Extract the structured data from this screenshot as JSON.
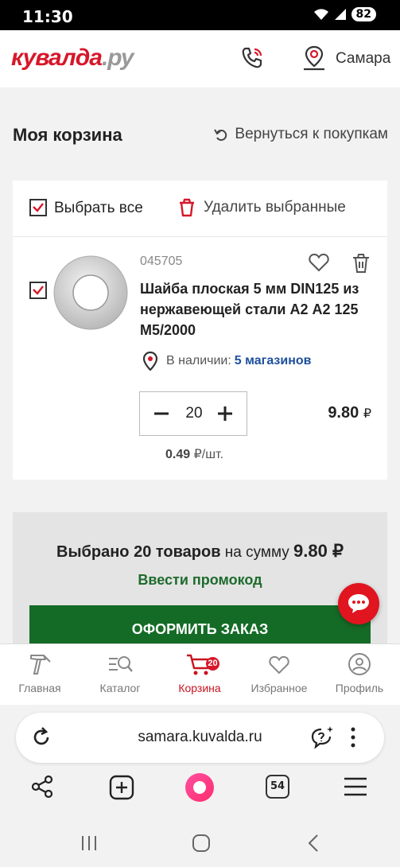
{
  "status_bar": {
    "time": "11:30",
    "battery": "82"
  },
  "header": {
    "logo_main": "кувалда",
    "logo_suffix": ".ру",
    "city": "Самара"
  },
  "page": {
    "title": "Моя корзина",
    "back_link": "Вернуться к покупкам"
  },
  "cart": {
    "select_all": "Выбрать все",
    "delete_selected": "Удалить выбранные",
    "item": {
      "sku": "045705",
      "title": "Шайба плоская 5 мм DIN125 из нержавеющей стали А2 А2 125 M5/2000",
      "availability_label": "В наличии:",
      "availability_stores": "5 магазинов",
      "quantity": "20",
      "total": "9.80",
      "currency": "₽",
      "unit_price": "0.49",
      "unit_suffix": "₽/шт."
    }
  },
  "summary": {
    "selected_count": "Выбрано 20 товаров",
    "on_sum": "на сумму",
    "sum": "9.80 ₽",
    "promo": "Ввести промокод",
    "checkout": "ОФОРМИТЬ ЗАКАЗ"
  },
  "bottom_nav": {
    "items": [
      {
        "label": "Главная",
        "icon": "hammer-icon"
      },
      {
        "label": "Каталог",
        "icon": "catalog-search-icon"
      },
      {
        "label": "Корзина",
        "icon": "cart-icon",
        "badge": "20",
        "active": true
      },
      {
        "label": "Избранное",
        "icon": "heart-icon"
      },
      {
        "label": "Профиль",
        "icon": "profile-icon"
      }
    ]
  },
  "browser": {
    "url": "samara.kuvalda.ru",
    "tabs_count": "54"
  },
  "colors": {
    "brand_red": "#d7172a",
    "checkout_green": "#146b26",
    "link_blue": "#1c4f9c"
  }
}
